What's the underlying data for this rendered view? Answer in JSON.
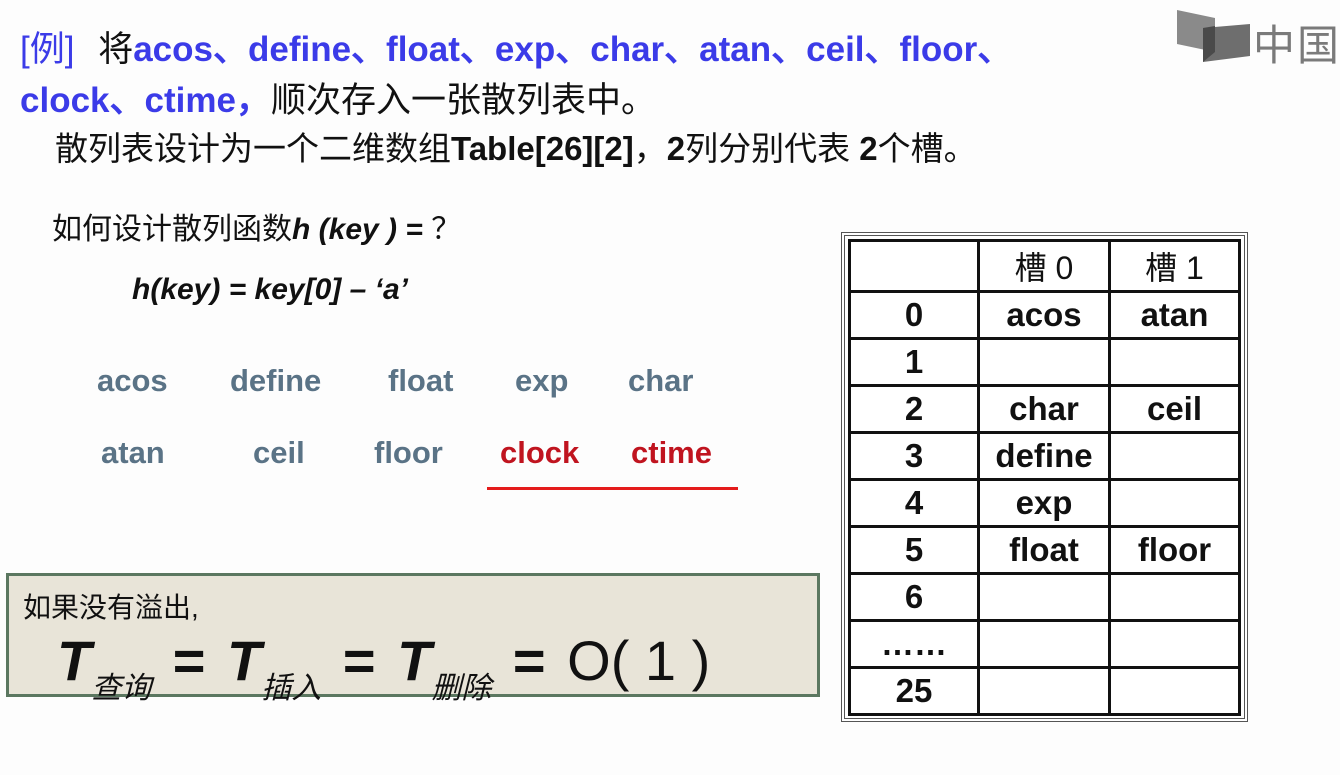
{
  "slide": {
    "intro": {
      "tag": "[例]",
      "verb": "将",
      "keys_line1": "acos、define、float、exp、char、atan、ceil、floor、",
      "keys_line2": "clock、ctime，",
      "tail": "顺次存入一张散列表中。"
    },
    "design": {
      "prefix": "散列表设计为一个二维数组",
      "array": "Table[26][2]",
      "sep": "，",
      "cols_num": "2",
      "cols_text": "列分别代表 ",
      "slots_num": "2",
      "slots_text": "个槽。"
    },
    "logo": {
      "icon": "book-logo-icon",
      "text": "中国大"
    },
    "question": {
      "text": "如何设计散列函数",
      "func": "h (key ) =",
      "mark": "？"
    },
    "formula": "h(key) = key[0] – ‘a’",
    "keys_row1": [
      "acos",
      "define",
      "float",
      "exp",
      "char"
    ],
    "keys_row2": [
      "atan",
      "ceil",
      "floor",
      "clock",
      "ctime"
    ],
    "highlight_color": "#c0141f",
    "key_color": "#5a7386",
    "accent_color": "#3b3be8",
    "summary": {
      "caption": "如果没有溢出,",
      "T": "T",
      "sub_search": "查询",
      "sub_insert": "插入",
      "sub_delete": "删除",
      "eq": "=",
      "result": "O( 1 )"
    },
    "table": {
      "headers": [
        "",
        "槽 0",
        "槽 1"
      ],
      "rows": [
        {
          "index": "0",
          "slot0": "acos",
          "slot1": "atan"
        },
        {
          "index": "1",
          "slot0": "",
          "slot1": ""
        },
        {
          "index": "2",
          "slot0": "char",
          "slot1": "ceil"
        },
        {
          "index": "3",
          "slot0": "define",
          "slot1": ""
        },
        {
          "index": "4",
          "slot0": "exp",
          "slot1": ""
        },
        {
          "index": "5",
          "slot0": "float",
          "slot1": "floor"
        },
        {
          "index": "6",
          "slot0": "",
          "slot1": ""
        },
        {
          "index": "……",
          "slot0": "",
          "slot1": ""
        },
        {
          "index": "25",
          "slot0": "",
          "slot1": ""
        }
      ]
    }
  }
}
